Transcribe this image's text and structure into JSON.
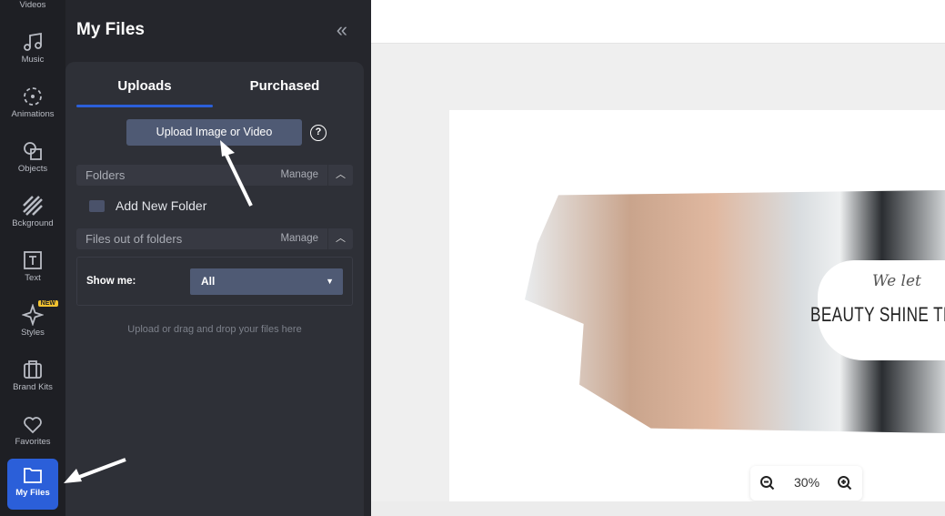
{
  "rail": {
    "items": [
      {
        "label": "Videos",
        "icon": "video-icon"
      },
      {
        "label": "Music",
        "icon": "music-icon"
      },
      {
        "label": "Animations",
        "icon": "animation-icon"
      },
      {
        "label": "Objects",
        "icon": "shapes-icon"
      },
      {
        "label": "Bckground",
        "icon": "background-icon"
      },
      {
        "label": "Text",
        "icon": "text-icon"
      },
      {
        "label": "Styles",
        "icon": "sparkle-icon",
        "badge": "NEW"
      },
      {
        "label": "Brand Kits",
        "icon": "briefcase-icon"
      },
      {
        "label": "Favorites",
        "icon": "heart-icon"
      },
      {
        "label": "My Files",
        "icon": "folder-icon",
        "active": true
      }
    ]
  },
  "panel": {
    "title": "My Files",
    "collapse": "«",
    "tabs": [
      {
        "label": "Uploads",
        "active": true
      },
      {
        "label": "Purchased"
      }
    ],
    "upload_button": "Upload Image or Video",
    "help": "?",
    "folders": {
      "label": "Folders",
      "manage": "Manage"
    },
    "add_folder": "Add New Folder",
    "files_out": {
      "label": "Files out of folders",
      "manage": "Manage"
    },
    "show_me": {
      "label": "Show me:",
      "value": "All"
    },
    "drop_hint": "Upload or drag and drop your files here"
  },
  "canvas": {
    "script_text": "We let",
    "headline": "BEAUTY SHINE THR"
  },
  "zoom": {
    "level": "30%"
  },
  "colors": {
    "accent": "#2b5fd9",
    "rail_bg": "#1e1f24",
    "panel_bg": "#25262c",
    "button": "#4f5a74"
  }
}
